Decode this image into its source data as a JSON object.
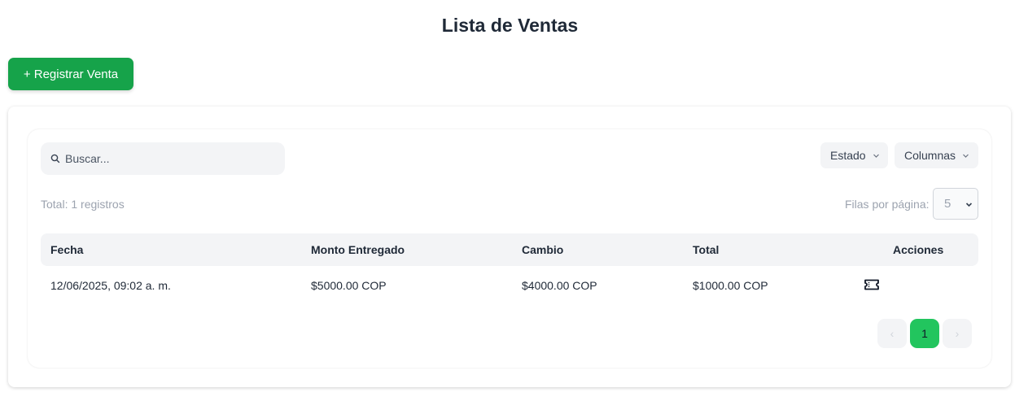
{
  "page": {
    "title": "Lista de Ventas"
  },
  "toolbar": {
    "add_label": "+ Registrar Venta"
  },
  "search": {
    "placeholder": "Buscar...",
    "value": ""
  },
  "filters": {
    "estado_label": "Estado",
    "columnas_label": "Columnas"
  },
  "summary": {
    "total_text": "Total: 1 registros",
    "rows_per_page_label": "Filas por página:",
    "rows_per_page_value": "5"
  },
  "table": {
    "columns": [
      "Fecha",
      "Monto Entregado",
      "Cambio",
      "Total",
      "Acciones"
    ],
    "rows": [
      {
        "fecha": "12/06/2025, 09:02 a. m.",
        "monto_entregado": "$5000.00 COP",
        "cambio": "$4000.00 COP",
        "total": "$1000.00 COP",
        "action_icon": "ticket-icon"
      }
    ]
  },
  "pagination": {
    "prev_symbol": "‹",
    "current_page": "1",
    "next_symbol": "›"
  },
  "colors": {
    "primary_button": "#16a34a",
    "active_page": "#22c55e",
    "header_bg": "#f3f4f6"
  }
}
